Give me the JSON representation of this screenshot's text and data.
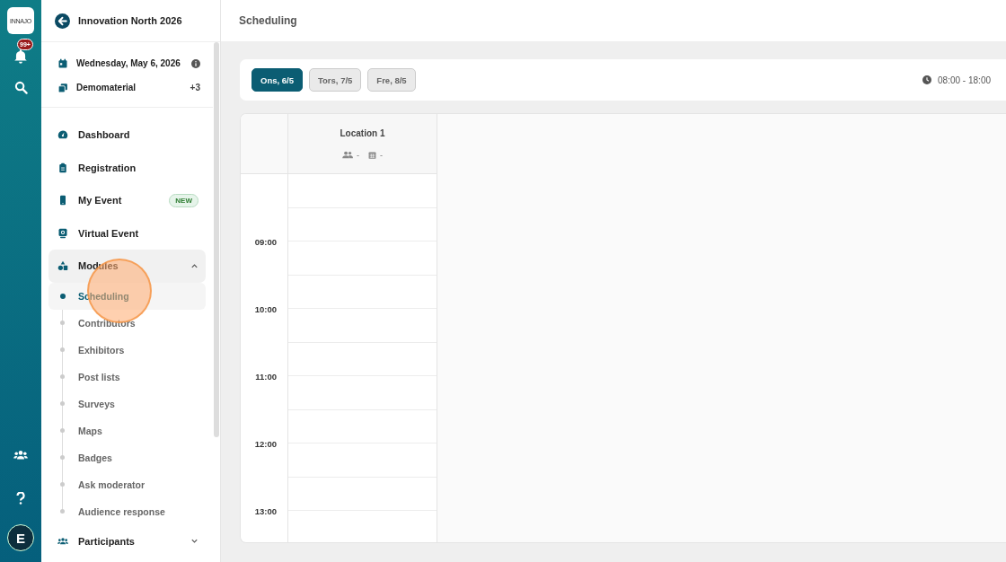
{
  "rail": {
    "logo_text": "INNAJO",
    "notification_badge": "99+",
    "avatar": "E"
  },
  "sidebar": {
    "event_title": "Innovation North 2026",
    "date": "Wednesday, May 6, 2026",
    "material": "Demomaterial",
    "material_count": "+3",
    "items": [
      {
        "label": "Dashboard"
      },
      {
        "label": "Registration"
      },
      {
        "label": "My Event",
        "badge": "NEW"
      },
      {
        "label": "Virtual Event"
      },
      {
        "label": "Modules",
        "expanded": true,
        "children": [
          {
            "label": "Scheduling",
            "selected": true
          },
          {
            "label": "Contributors",
            "selected": false
          },
          {
            "label": "Exhibitors",
            "selected": false
          },
          {
            "label": "Post lists",
            "selected": false
          },
          {
            "label": "Surveys",
            "selected": false
          },
          {
            "label": "Maps",
            "selected": false
          },
          {
            "label": "Badges",
            "selected": false
          },
          {
            "label": "Ask moderator",
            "selected": false
          },
          {
            "label": "Audience response",
            "selected": false
          }
        ]
      },
      {
        "label": "Participants",
        "expanded": false
      }
    ]
  },
  "page_title": "Scheduling",
  "day_tabs": [
    {
      "label": "Ons, 6/5",
      "selected": true
    },
    {
      "label": "Tors, 7/5",
      "selected": false
    },
    {
      "label": "Fre, 8/5",
      "selected": false
    }
  ],
  "time_range": "08:00 - 18:00",
  "calendar": {
    "locations": [
      {
        "name": "Location 1",
        "participants": "-",
        "sessions": "-"
      }
    ],
    "hours": [
      "09:00",
      "10:00",
      "11:00",
      "12:00",
      "13:00"
    ]
  }
}
